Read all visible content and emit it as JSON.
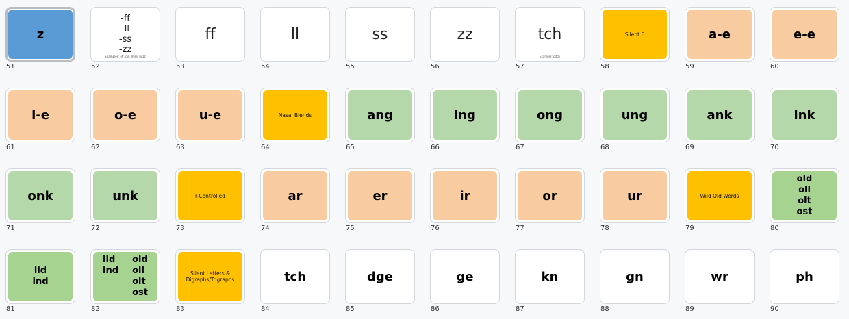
{
  "colors": {
    "blue": "#5b9bd5",
    "peach": "#f8cba0",
    "gold": "#ffc000",
    "green": "#b4d8a9",
    "green_dark": "#a6d38f",
    "white": "#ffffff"
  },
  "slides": [
    {
      "num": "51",
      "kind": "big",
      "color": "blue",
      "text": "z",
      "selected": true
    },
    {
      "num": "52",
      "kind": "stack",
      "color": "white",
      "lines": [
        "-ff",
        "-ll",
        "-ss",
        "-zz"
      ],
      "note": "Examples: off, pill, miss, buzz"
    },
    {
      "num": "53",
      "kind": "thin",
      "color": "white",
      "text": "ff"
    },
    {
      "num": "54",
      "kind": "thin",
      "color": "white",
      "text": "ll"
    },
    {
      "num": "55",
      "kind": "thin",
      "color": "white",
      "text": "ss"
    },
    {
      "num": "56",
      "kind": "thin",
      "color": "white",
      "text": "zz"
    },
    {
      "num": "57",
      "kind": "thin",
      "color": "white",
      "text": "tch",
      "note": "Example: pitch"
    },
    {
      "num": "58",
      "kind": "tiny",
      "color": "gold",
      "text": "Silent E"
    },
    {
      "num": "59",
      "kind": "big",
      "color": "peach",
      "text": "a-e"
    },
    {
      "num": "60",
      "kind": "big",
      "color": "peach",
      "text": "e-e"
    },
    {
      "num": "61",
      "kind": "big",
      "color": "peach",
      "text": "i-e"
    },
    {
      "num": "62",
      "kind": "big",
      "color": "peach",
      "text": "o-e"
    },
    {
      "num": "63",
      "kind": "big",
      "color": "peach",
      "text": "u-e"
    },
    {
      "num": "64",
      "kind": "tiny",
      "color": "gold",
      "text": "Nasal Blends"
    },
    {
      "num": "65",
      "kind": "big",
      "color": "green",
      "text": "ang"
    },
    {
      "num": "66",
      "kind": "big",
      "color": "green",
      "text": "ing"
    },
    {
      "num": "67",
      "kind": "big",
      "color": "green",
      "text": "ong"
    },
    {
      "num": "68",
      "kind": "big",
      "color": "green",
      "text": "ung"
    },
    {
      "num": "69",
      "kind": "big",
      "color": "green",
      "text": "ank"
    },
    {
      "num": "70",
      "kind": "big",
      "color": "green",
      "text": "ink"
    },
    {
      "num": "71",
      "kind": "big",
      "color": "green",
      "text": "onk"
    },
    {
      "num": "72",
      "kind": "big",
      "color": "green",
      "text": "unk"
    },
    {
      "num": "73",
      "kind": "tiny",
      "color": "gold",
      "text": "r-Controlled"
    },
    {
      "num": "74",
      "kind": "big",
      "color": "peach",
      "text": "ar"
    },
    {
      "num": "75",
      "kind": "big",
      "color": "peach",
      "text": "er"
    },
    {
      "num": "76",
      "kind": "big",
      "color": "peach",
      "text": "ir"
    },
    {
      "num": "77",
      "kind": "big",
      "color": "peach",
      "text": "or"
    },
    {
      "num": "78",
      "kind": "big",
      "color": "peach",
      "text": "ur"
    },
    {
      "num": "79",
      "kind": "tiny",
      "color": "gold",
      "text": "Wild Old Words"
    },
    {
      "num": "80",
      "kind": "stack-bold",
      "color": "green_dark",
      "lines": [
        "old",
        "oll",
        "olt",
        "ost"
      ]
    },
    {
      "num": "81",
      "kind": "stack-bold",
      "color": "green_dark",
      "lines": [
        "ild",
        "ind"
      ]
    },
    {
      "num": "82",
      "kind": "twocol",
      "color": "green_dark",
      "left": [
        "ild",
        "ind"
      ],
      "right": [
        "old",
        "oll",
        "olt",
        "ost"
      ]
    },
    {
      "num": "83",
      "kind": "tiny",
      "color": "gold",
      "text": "Silent Letters & Digraphs/Trigraphs"
    },
    {
      "num": "84",
      "kind": "big",
      "color": "white",
      "text": "tch"
    },
    {
      "num": "85",
      "kind": "big",
      "color": "white",
      "text": "dge"
    },
    {
      "num": "86",
      "kind": "big",
      "color": "white",
      "text": "ge"
    },
    {
      "num": "87",
      "kind": "big",
      "color": "white",
      "text": "kn"
    },
    {
      "num": "88",
      "kind": "big",
      "color": "white",
      "text": "gn"
    },
    {
      "num": "89",
      "kind": "big",
      "color": "white",
      "text": "wr"
    },
    {
      "num": "90",
      "kind": "big",
      "color": "white",
      "text": "ph"
    }
  ]
}
